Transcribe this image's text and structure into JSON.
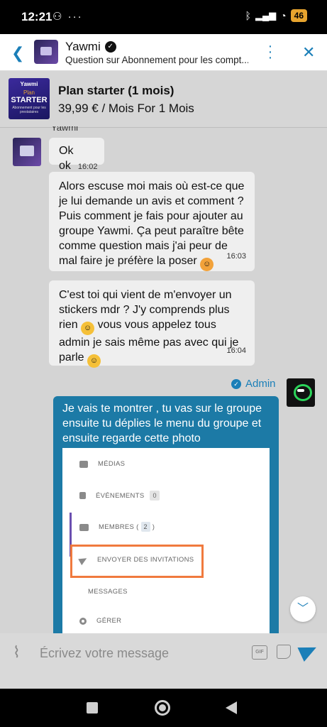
{
  "status_bar": {
    "time": "12:21",
    "left_icons": "⚇ ···",
    "battery": "46"
  },
  "header": {
    "title": "Yawmi",
    "subtitle": "Question sur Abonnement pour les compt..."
  },
  "product": {
    "image_text": [
      "Yawmi",
      "Plan",
      "STARTER",
      "Abonnement pour les prestataires"
    ],
    "name": "Plan starter (1 mois)",
    "price": "39,99 € / Mois For 1 Mois"
  },
  "messages": [
    {
      "sender": "Yawmi",
      "text": "Ok ok",
      "time": "16:02"
    },
    {
      "text": "Alors escuse moi mais où est-ce que je lui demande un avis et comment ? Puis comment je fais pour ajouter au groupe Yawmi. Ça peut paraître bête comme question mais j'ai peur de mal faire je préfère la poser",
      "time": "16:03"
    },
    {
      "text_a": "C'est toi qui vient de m'envoyer un stickers mdr ? J'y comprends plus rien",
      "text_b": "vous vous appelez tous admin je sais même pas avec qui je parle",
      "time": "16:04"
    }
  ],
  "admin": {
    "label": "Admin",
    "text": "Je vais te montrer , tu vas sur le groupe ensuite tu déplies le menu du groupe et ensuite regarde cette photo"
  },
  "photo_menu": {
    "medias": "MÉDIAS",
    "evenements": "ÉVÉNEMENTS",
    "evenements_count": "0",
    "membres": "MEMBRES (",
    "membres_count": "2",
    "membres_close": ")",
    "invitations": "ENVOYER DES INVITATIONS",
    "messages": "MESSAGES",
    "gerer": "GÉRER"
  },
  "composer": {
    "placeholder": "Écrivez votre message",
    "gif_label": "GIF"
  },
  "colors": {
    "accent": "#1b7fb8",
    "admin_bubble": "#1c7aa6",
    "highlight": "#f07a3e"
  }
}
